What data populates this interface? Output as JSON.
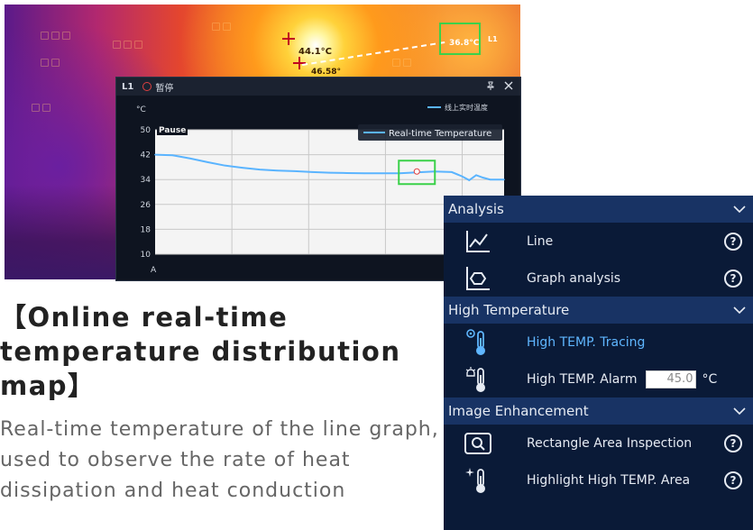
{
  "thermal": {
    "hot_spot_label": "44.1°C",
    "hot_spot_sub_label": "46.58°",
    "point_label": "36.8°C",
    "side_marker": "L1"
  },
  "chart_window": {
    "id": "L1",
    "state": "暂停",
    "pin_icon": "pin-icon",
    "close_icon": "close-icon",
    "legend_small": "线上实时温度",
    "unit": "°C",
    "pause_tag": "Pause",
    "x_label": "A",
    "legend_label": "Real-time Temperature"
  },
  "chart_data": {
    "type": "line",
    "ylabel": "°C",
    "xlabel": "A",
    "ylim": [
      10,
      50
    ],
    "yticks": [
      10,
      18,
      26,
      34,
      42,
      50
    ],
    "grid": true,
    "series": [
      {
        "name": "Real-time Temperature",
        "x": [
          0,
          0.05,
          0.1,
          0.15,
          0.2,
          0.25,
          0.3,
          0.35,
          0.4,
          0.45,
          0.5,
          0.55,
          0.6,
          0.65,
          0.7,
          0.75,
          0.8,
          0.85,
          0.88,
          0.9,
          0.92,
          0.94,
          0.96,
          1.0
        ],
        "values": [
          42,
          41.8,
          40.8,
          39.6,
          38.5,
          37.8,
          37.2,
          36.9,
          36.7,
          36.4,
          36.2,
          36.1,
          36.0,
          36.0,
          36.0,
          36.3,
          36.6,
          36.4,
          35.0,
          33.8,
          35.4,
          34.6,
          34.0,
          34.0
        ]
      }
    ],
    "highlight_point": {
      "x": 0.75,
      "y": 36.6
    }
  },
  "headline": "【Online real-time temperature distribution map】",
  "subtext": "Real-time temperature of the line graph, used to observe the rate of heat dissipation and heat conduction",
  "panel": {
    "sections": [
      {
        "title": "Analysis",
        "items": [
          {
            "label": "Line",
            "icon": "line-chart-icon",
            "help": "?"
          },
          {
            "label": "Graph analysis",
            "icon": "graph-analysis-icon",
            "help": "?"
          }
        ]
      },
      {
        "title": "High Temperature",
        "items": [
          {
            "label": "High TEMP. Tracing",
            "icon": "thermometer-pin-icon"
          },
          {
            "label": "High TEMP. Alarm",
            "icon": "thermometer-alarm-icon",
            "value": "45.0",
            "unit": "°C"
          }
        ]
      },
      {
        "title": "Image Enhancement",
        "items": [
          {
            "label": "Rectangle Area Inspection",
            "icon": "rectangle-inspection-icon",
            "help": "?"
          },
          {
            "label": "Highlight High TEMP. Area",
            "icon": "thermometer-highlight-icon",
            "help": "?"
          }
        ]
      }
    ]
  },
  "colors": {
    "panel_bg": "#0a1a37",
    "section_bg": "#183364",
    "accent_blue": "#5fb6ff",
    "chart_line": "#5ab4ff",
    "highlight_box": "#3bd14a"
  }
}
